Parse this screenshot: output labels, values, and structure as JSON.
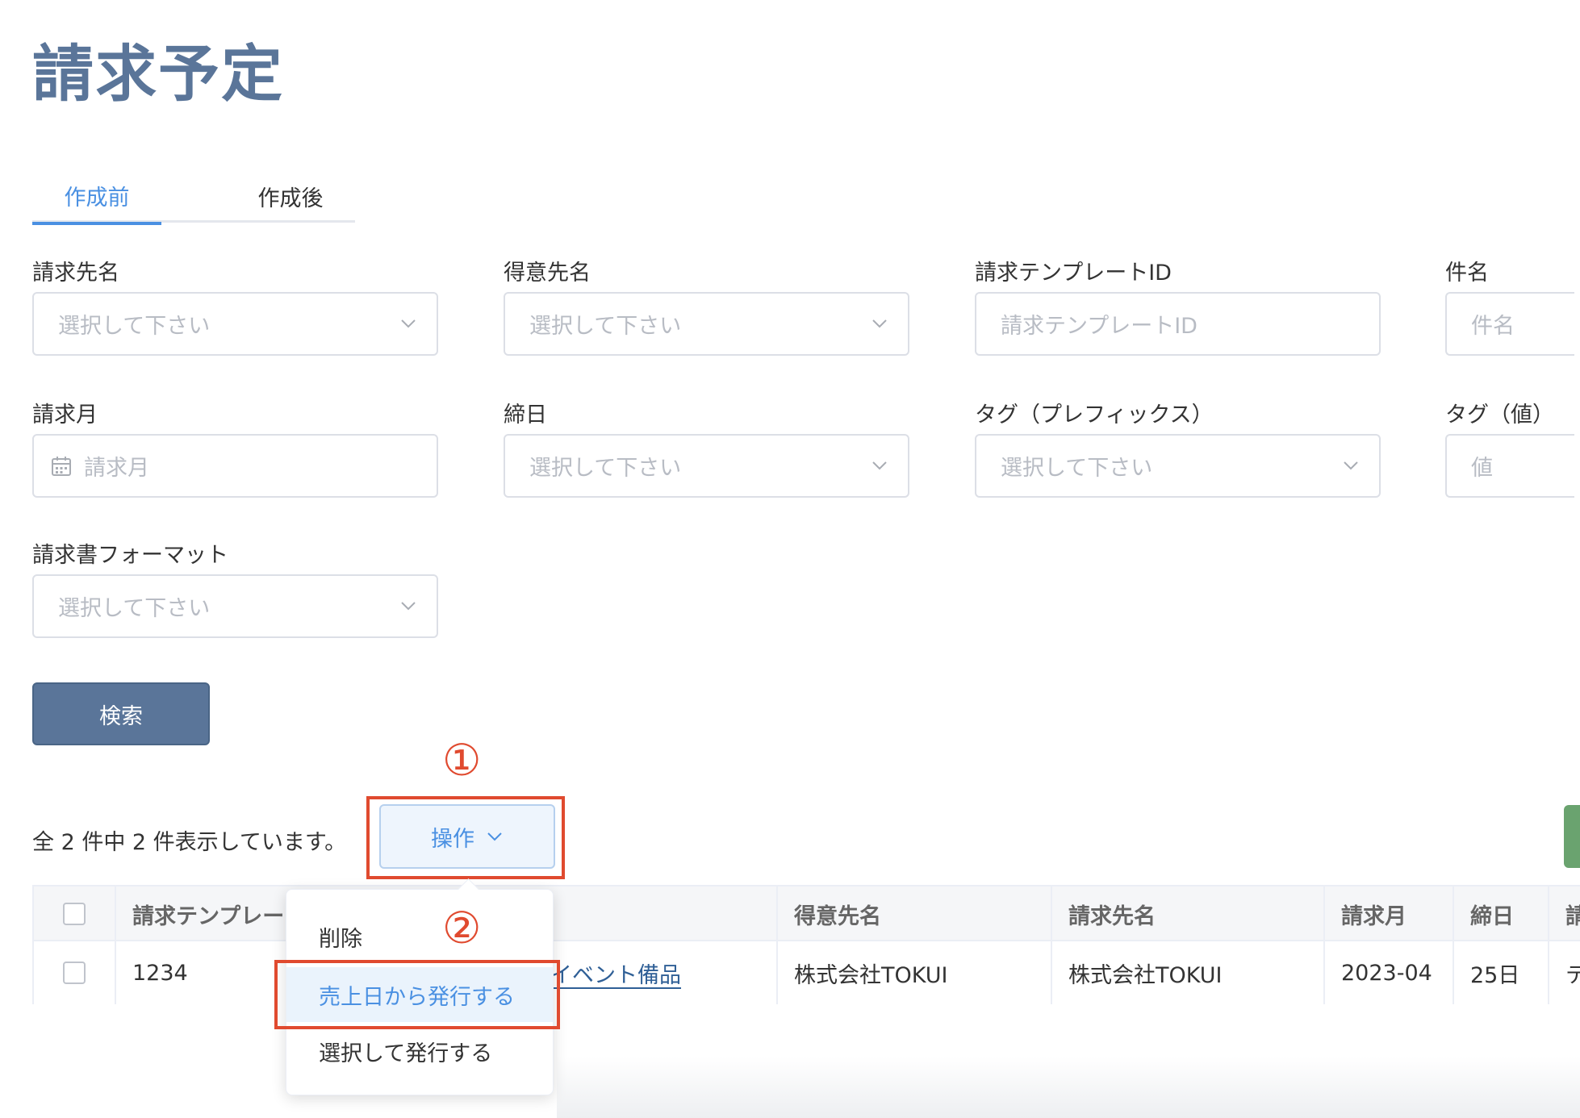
{
  "page": {
    "title": "請求予定"
  },
  "tabs": [
    {
      "label": "作成前",
      "active": true
    },
    {
      "label": "作成後",
      "active": false
    }
  ],
  "filters": {
    "billing_name": {
      "label": "請求先名",
      "placeholder": "選択して下さい"
    },
    "customer_name": {
      "label": "得意先名",
      "placeholder": "選択して下さい"
    },
    "template_id": {
      "label": "請求テンプレートID",
      "placeholder": "請求テンプレートID"
    },
    "subject": {
      "label": "件名",
      "placeholder": "件名"
    },
    "billing_month": {
      "label": "請求月",
      "placeholder": "請求月"
    },
    "closing_day": {
      "label": "締日",
      "placeholder": "選択して下さい"
    },
    "tag_prefix": {
      "label": "タグ（プレフィックス）",
      "placeholder": "選択して下さい"
    },
    "tag_value": {
      "label": "タグ（値）",
      "placeholder": "値"
    },
    "invoice_format": {
      "label": "請求書フォーマット",
      "placeholder": "選択して下さい"
    }
  },
  "search_button": {
    "label": "検索"
  },
  "results": {
    "count_text": "全 2 件中 2 件表示しています。"
  },
  "operations": {
    "label": "操作",
    "menu": [
      {
        "label": "削除"
      },
      {
        "label": "売上日から発行する",
        "highlighted": true
      },
      {
        "label": "選択して発行する"
      }
    ]
  },
  "annotations": {
    "step1": "①",
    "step2": "②"
  },
  "table": {
    "headers": [
      "請求テンプレー",
      "得意先名",
      "請求先名",
      "請求月",
      "締日",
      "請"
    ],
    "rows": [
      {
        "template_id": "1234",
        "subject": "イベント備品",
        "customer": "株式会社TOKUI",
        "billing": "株式会社TOKUI",
        "month": "2023-04",
        "closing": "25日",
        "extra": "テ"
      }
    ]
  },
  "colors": {
    "brand": "#5a7599",
    "accent": "#4a90e2",
    "annotation": "#e04a2f",
    "success": "#6aa36f"
  }
}
